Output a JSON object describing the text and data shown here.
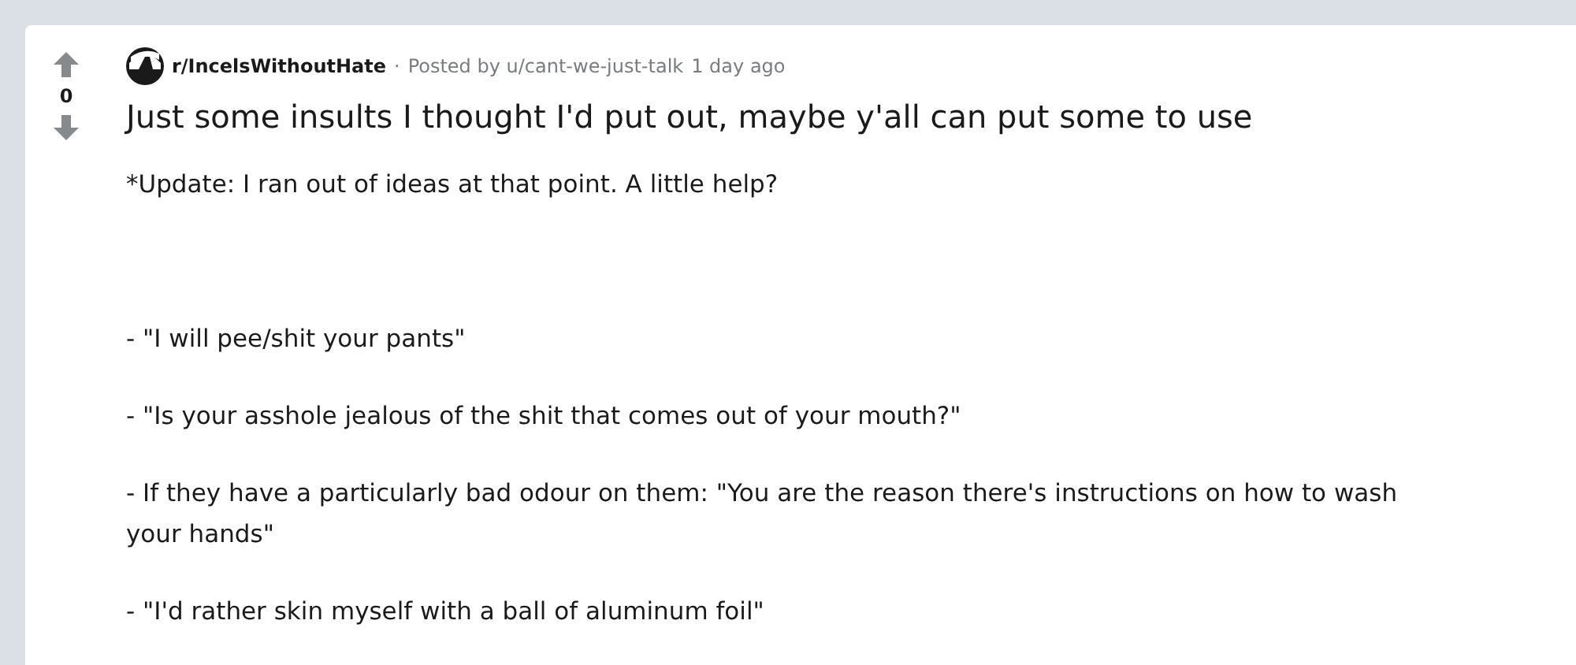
{
  "post": {
    "score": "0",
    "subreddit": "r/IncelsWithoutHate",
    "separator": "·",
    "posted_by": "Posted by u/cant-we-just-talk",
    "time": "1 day ago",
    "title": "Just some insults I thought I'd put out, maybe y'all can put some to use",
    "paragraphs": [
      "*Update: I ran out of ideas at that point. A little help?",
      "- \"I will pee/shit your pants\"",
      "- \"Is your asshole jealous of the shit that comes out of your mouth?\"",
      "- If they have a particularly bad odour on them: \"You are the reason there's instructions on how to wash your hands\"",
      "- \"I'd rather skin myself with a ball of aluminum foil\""
    ]
  }
}
